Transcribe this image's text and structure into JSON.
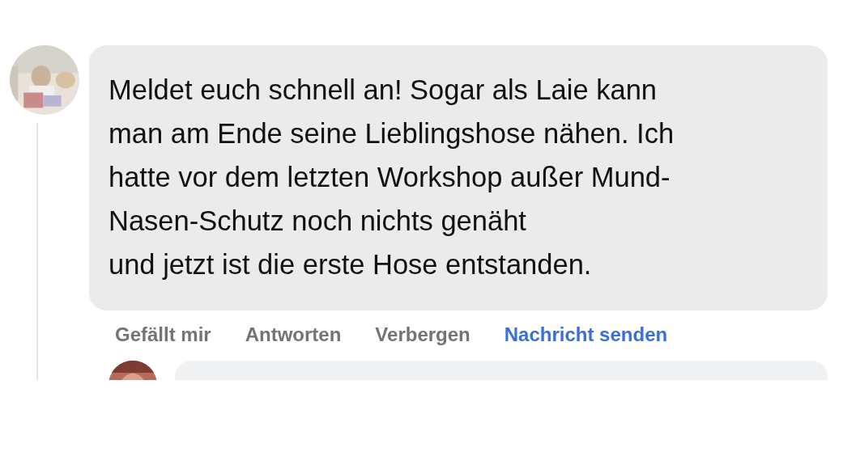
{
  "comment": {
    "text": "Meldet euch schnell an! Sogar als Laie kann\nman am Ende seine Lieblingshose nähen. Ich\nhatte vor dem letzten Workshop außer Mund-\nNasen-Schutz noch nichts genäht\nund jetzt ist die erste Hose entstanden.",
    "actions": [
      {
        "label": "Gefällt mir",
        "kind": "plain"
      },
      {
        "label": "Antworten",
        "kind": "plain"
      },
      {
        "label": "Verbergen",
        "kind": "plain"
      },
      {
        "label": "Nachricht senden",
        "kind": "link"
      }
    ]
  }
}
